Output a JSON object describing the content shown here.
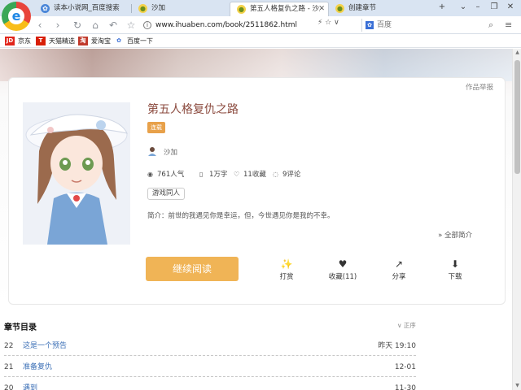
{
  "browser": {
    "logo_letter": "e",
    "tabs": [
      {
        "title": "读本小说网_百度搜索",
        "icon": "paw-icon"
      },
      {
        "title": "沙加",
        "icon": "bubble-icon"
      },
      {
        "title": "第五人格复仇之路 - 沙加",
        "icon": "bubble-icon",
        "active": true
      },
      {
        "title": "创建章节",
        "icon": "bubble-icon"
      }
    ],
    "new_tab": "+",
    "window_controls": {
      "chevron": "⌄",
      "minimize": "–",
      "restore": "❐",
      "close": "✕"
    },
    "nav": {
      "back": "‹",
      "forward": "›",
      "reload": "↻",
      "home": "⌂",
      "undo": "↶",
      "favorite": "☆"
    },
    "address": "www.ihuaben.com/book/2511862.html",
    "address_tools": "⚡ ☆ ∨",
    "search": {
      "engine_icon": "baidu-icon",
      "placeholder": "百度"
    },
    "search_btn": "⌕",
    "menu_btn": "≡",
    "bookmarks": [
      {
        "label": "京东",
        "icon": "JD",
        "color": "#e1251b"
      },
      {
        "label": "天猫精选",
        "icon": "T",
        "color": "#d81e06"
      },
      {
        "label": "爱淘宝",
        "icon": "淘",
        "color": "#c0392b"
      },
      {
        "label": "百度一下",
        "icon": "✿",
        "color": "#3a6fd6"
      }
    ]
  },
  "book": {
    "report": "作品举报",
    "title": "第五人格复仇之路",
    "status": "连载",
    "author": "沙加",
    "stats": {
      "popularity": "761人气",
      "words": "1万字",
      "favorites": "11收藏",
      "comments": "9评论"
    },
    "tag": "游戏同人",
    "intro": "简介：前世的我遇见你是幸运，但，今世遇见你是我的不幸。",
    "full_intro": "全部简介",
    "read_button": "继续阅读",
    "actions": [
      {
        "label": "打赏",
        "icon": "magic-wand-icon",
        "glyph": "✨"
      },
      {
        "label": "收藏(11)",
        "icon": "heart-icon",
        "glyph": "♥"
      },
      {
        "label": "分享",
        "icon": "share-icon",
        "glyph": "↗"
      },
      {
        "label": "下载",
        "icon": "download-icon",
        "glyph": "⬇"
      }
    ]
  },
  "toc": {
    "title": "章节目录",
    "sort": "正序",
    "chapters": [
      {
        "num": "22",
        "title": "这是一个预告",
        "date": "昨天 19:10"
      },
      {
        "num": "21",
        "title": "准备复仇",
        "date": "12-01"
      },
      {
        "num": "20",
        "title": "遇到",
        "date": "11-30"
      }
    ]
  }
}
